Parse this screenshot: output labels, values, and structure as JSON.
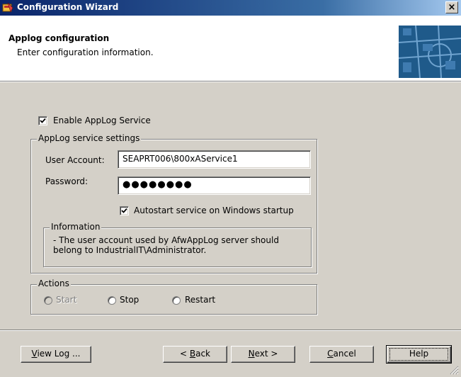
{
  "window": {
    "title": "Configuration Wizard",
    "close_glyph": "×"
  },
  "header": {
    "title": "Applog configuration",
    "subtitle": "Enter configuration information."
  },
  "enable_service": {
    "label": "Enable AppLog Service",
    "checked": true
  },
  "service_settings": {
    "legend": "AppLog service settings",
    "user_account_label": "User Account:",
    "user_account_value": "SEAPRT006\\800xAService1",
    "password_label": "Password:",
    "password_mask": "●●●●●●●●",
    "autostart_label": "Autostart service on Windows startup",
    "autostart_checked": true
  },
  "information": {
    "legend": "Information",
    "line1": "- The user account used by AfwAppLog server should",
    "line2": "belong to IndustrialIT\\Administrator."
  },
  "actions": {
    "legend": "Actions",
    "start_label": "Start",
    "start_enabled": false,
    "stop_label": "Stop",
    "restart_label": "Restart"
  },
  "buttons": {
    "view_log": {
      "mnemonic": "V",
      "rest": "iew Log ..."
    },
    "back": {
      "prefix": "< ",
      "mnemonic": "B",
      "rest": "ack"
    },
    "next": {
      "mnemonic": "N",
      "rest": "ext >"
    },
    "cancel": {
      "mnemonic": "C",
      "rest": "ancel"
    },
    "help": {
      "label": "Help"
    }
  }
}
